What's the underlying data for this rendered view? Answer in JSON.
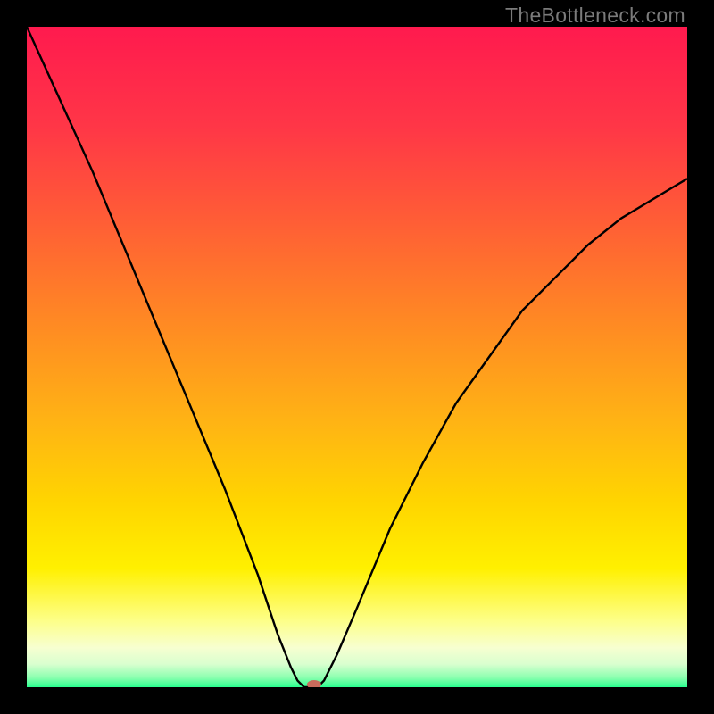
{
  "watermark": "TheBottleneck.com",
  "chart_data": {
    "type": "line",
    "title": "",
    "xlabel": "",
    "ylabel": "",
    "xlim": [
      0,
      100
    ],
    "ylim": [
      0,
      100
    ],
    "grid": false,
    "legend": false,
    "background": {
      "type": "vertical-gradient",
      "stops": [
        {
          "pos": 0.0,
          "color": "#ff1a4e"
        },
        {
          "pos": 0.15,
          "color": "#ff3647"
        },
        {
          "pos": 0.3,
          "color": "#ff5f35"
        },
        {
          "pos": 0.45,
          "color": "#ff8a23"
        },
        {
          "pos": 0.6,
          "color": "#ffb414"
        },
        {
          "pos": 0.72,
          "color": "#ffd500"
        },
        {
          "pos": 0.82,
          "color": "#fff000"
        },
        {
          "pos": 0.9,
          "color": "#fdff8a"
        },
        {
          "pos": 0.94,
          "color": "#f7ffd0"
        },
        {
          "pos": 0.965,
          "color": "#d9ffcf"
        },
        {
          "pos": 0.985,
          "color": "#8dffb0"
        },
        {
          "pos": 1.0,
          "color": "#2aff8f"
        }
      ]
    },
    "series": [
      {
        "name": "bottleneck-curve-left",
        "stroke": "#000000",
        "x": [
          0,
          5,
          10,
          15,
          20,
          25,
          30,
          35,
          38,
          40,
          41,
          42,
          43
        ],
        "y": [
          100,
          89,
          78,
          66,
          54,
          42,
          30,
          17,
          8,
          3,
          1,
          0,
          0
        ]
      },
      {
        "name": "bottleneck-curve-right",
        "stroke": "#000000",
        "x": [
          44,
          45,
          47,
          50,
          55,
          60,
          65,
          70,
          75,
          80,
          85,
          90,
          95,
          100
        ],
        "y": [
          0,
          1,
          5,
          12,
          24,
          34,
          43,
          50,
          57,
          62,
          67,
          71,
          74,
          77
        ]
      }
    ],
    "marker": {
      "name": "optimal-point",
      "x": 43.5,
      "y": 0,
      "color": "#c96b5c",
      "rx": 8,
      "ry": 5
    }
  }
}
